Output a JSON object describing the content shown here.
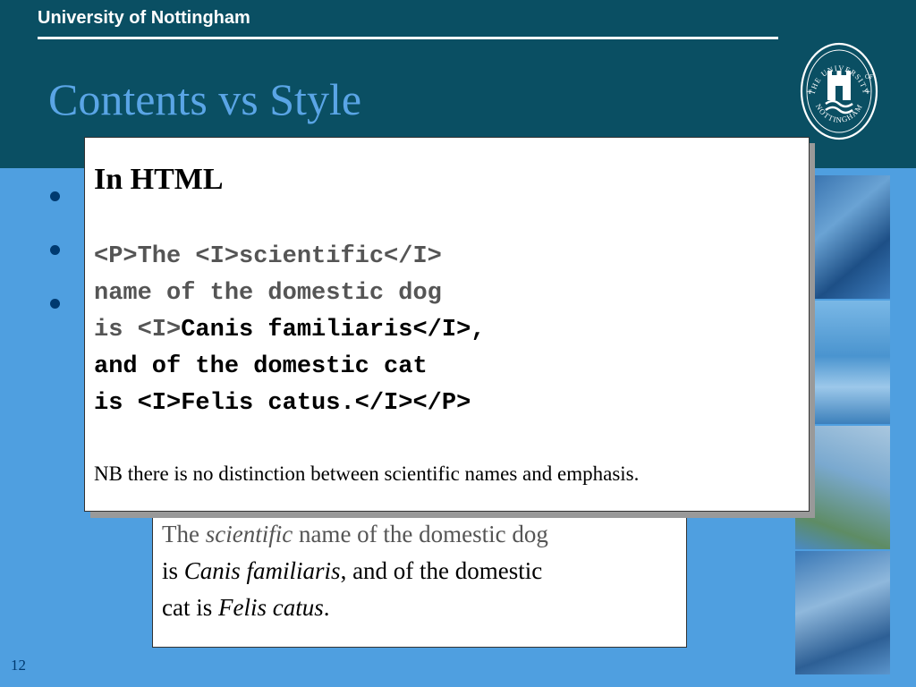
{
  "header": {
    "university_name": "University of Nottingham",
    "logo": {
      "icon": "university-of-nottingham-crest-icon",
      "text_top": "THE UNIVERSITY",
      "text_of": "OF",
      "text_bottom": "NOTTINGHAM"
    }
  },
  "slide": {
    "title": "Contents vs Style",
    "page_number": "12"
  },
  "html_box": {
    "heading": "In HTML",
    "code_lines": [
      [
        {
          "text": "<P>The <I>scientific</I>",
          "tone": "grey"
        }
      ],
      [
        {
          "text": "name of the domestic dog",
          "tone": "grey"
        }
      ],
      [
        {
          "text": "is <I>",
          "tone": "grey"
        },
        {
          "text": "Canis familiaris</I>,",
          "tone": "black"
        }
      ],
      [
        {
          "text": "and of the domestic cat",
          "tone": "black"
        }
      ],
      [
        {
          "text": "is <I>Felis catus.</I></P>",
          "tone": "black"
        }
      ]
    ],
    "note": "NB there is no distinction between scientific names and emphasis."
  },
  "rendered_box": {
    "line1_before": "The ",
    "line1_italic": "scientific",
    "line1_after": " name of the domestic dog",
    "line2_before": "is ",
    "line2_italic": "Canis familiaris",
    "line2_after": ", and of the domestic",
    "line3_before": "cat is ",
    "line3_italic": "Felis catus",
    "line3_after": "."
  },
  "colors": {
    "header_bg": "#0a4f63",
    "slide_bg": "#4f9fe0",
    "title": "#5aa5e6",
    "bullet": "#003a70"
  }
}
